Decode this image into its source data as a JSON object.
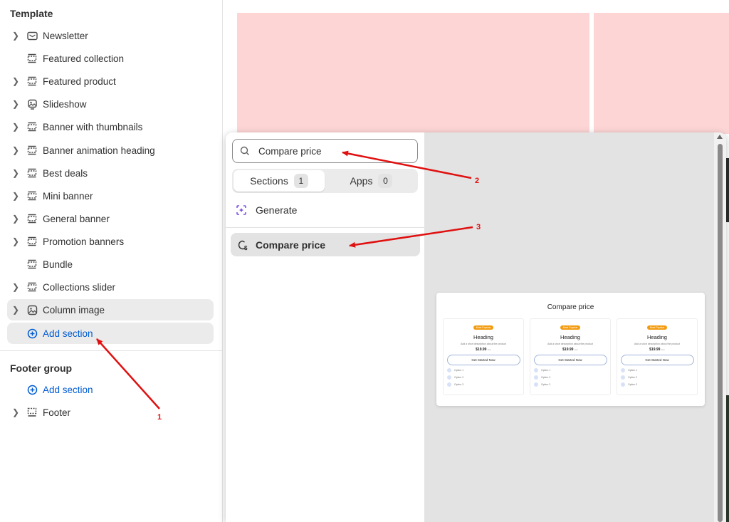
{
  "sidebar": {
    "template_title": "Template",
    "items": [
      {
        "label": "Newsletter",
        "icon": "envelope-icon",
        "chevron": true
      },
      {
        "label": "Featured collection",
        "icon": "section-icon",
        "chevron": false
      },
      {
        "label": "Featured product",
        "icon": "section-icon",
        "chevron": true
      },
      {
        "label": "Slideshow",
        "icon": "slideshow-icon",
        "chevron": true
      },
      {
        "label": "Banner with thumbnails",
        "icon": "section-icon",
        "chevron": true
      },
      {
        "label": "Banner animation heading",
        "icon": "section-icon",
        "chevron": true
      },
      {
        "label": "Best deals",
        "icon": "section-icon",
        "chevron": true
      },
      {
        "label": "Mini banner",
        "icon": "section-icon",
        "chevron": true
      },
      {
        "label": "General banner",
        "icon": "section-icon",
        "chevron": true
      },
      {
        "label": "Promotion banners",
        "icon": "section-icon",
        "chevron": true
      },
      {
        "label": "Bundle",
        "icon": "section-icon",
        "chevron": false
      },
      {
        "label": "Collections slider",
        "icon": "section-icon",
        "chevron": true
      },
      {
        "label": "Column image",
        "icon": "image-icon",
        "chevron": true
      }
    ],
    "add_section_label": "Add section",
    "footer_group_title": "Footer group",
    "footer_add_section_label": "Add section",
    "footer_item": {
      "label": "Footer",
      "icon": "footer-icon"
    }
  },
  "picker": {
    "search_value": "Compare price",
    "tabs": [
      {
        "label": "Sections",
        "count": "1"
      },
      {
        "label": "Apps",
        "count": "0"
      }
    ],
    "generate_label": "Generate",
    "result_label": "Compare price"
  },
  "preview": {
    "title": "Compare price",
    "cards": [
      {
        "badge": "Most Popular",
        "heading": "Heading",
        "desc": "Add a short description about the product",
        "price": "$19.99",
        "period": "/mo",
        "button": "Get Started Now",
        "options": [
          "Option 1",
          "Option 2",
          "Option 3"
        ]
      },
      {
        "badge": "Most Popular",
        "heading": "Heading",
        "desc": "Add a short description about the product",
        "price": "$19.99",
        "period": "/mo",
        "button": "Get Started Now",
        "options": [
          "Option 1",
          "Option 2",
          "Option 3"
        ]
      },
      {
        "badge": "Most Popular",
        "heading": "Heading",
        "desc": "Add a short description about the product",
        "price": "$19.99",
        "period": "/mo",
        "button": "Get Started Now",
        "options": [
          "Option 1",
          "Option 2",
          "Option 3"
        ]
      }
    ]
  },
  "annotations": {
    "a1": "1",
    "a2": "2",
    "a3": "3"
  },
  "colors": {
    "accent_blue": "#005bd3",
    "annotation_red": "#e01010",
    "banner_pink": "#fdd5d5",
    "badge_orange": "#f39c12"
  }
}
